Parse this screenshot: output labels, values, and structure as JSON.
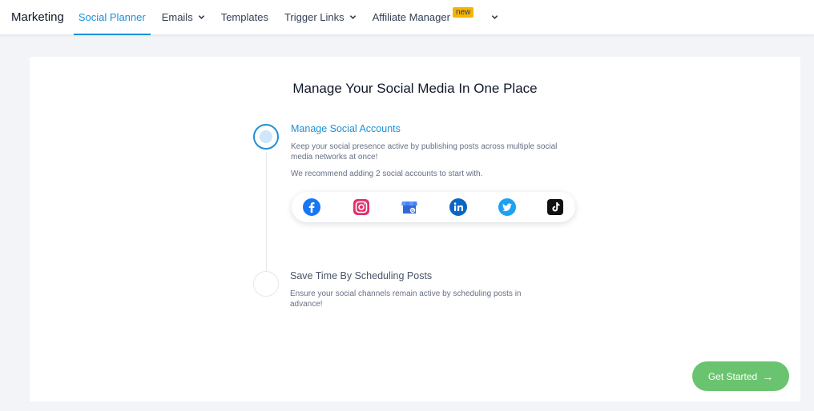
{
  "nav": {
    "brand": "Marketing",
    "tabs": [
      {
        "label": "Social Planner",
        "active": true
      },
      {
        "label": "Emails",
        "has_dropdown": true
      },
      {
        "label": "Templates"
      },
      {
        "label": "Trigger Links",
        "has_dropdown": true
      },
      {
        "label": "Affiliate Manager",
        "badge": "new"
      }
    ],
    "more_icon": "chevron-down-icon"
  },
  "main": {
    "title": "Manage Your Social Media In One Place",
    "steps": [
      {
        "title": "Manage Social Accounts",
        "description": "Keep your social presence active by publishing posts across multiple social media networks at once!",
        "note": "We recommend adding 2 social accounts to start with.",
        "active": true
      },
      {
        "title": "Save Time By Scheduling Posts",
        "description": "Ensure your social channels remain active by scheduling posts in advance!",
        "active": false
      }
    ],
    "social_networks": [
      "facebook-icon",
      "instagram-icon",
      "google-business-icon",
      "linkedin-icon",
      "twitter-icon",
      "tiktok-icon"
    ]
  },
  "cta": {
    "label": "Get Started",
    "arrow": "→"
  },
  "colors": {
    "accent": "#1e90d6",
    "cta": "#6ac46f",
    "badge": "#f5b400",
    "background": "#f2f4f7"
  }
}
